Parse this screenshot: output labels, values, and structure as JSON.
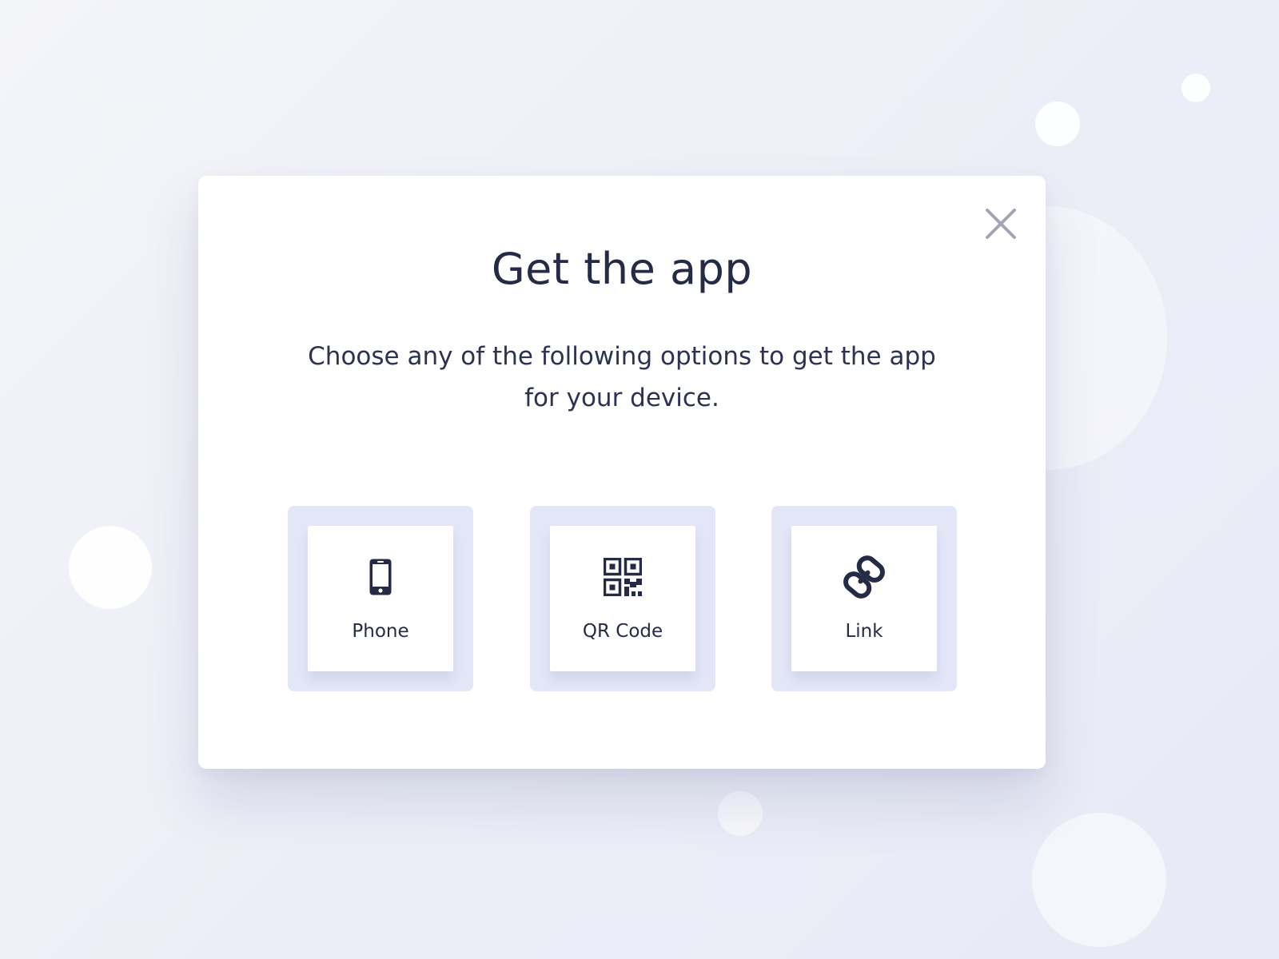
{
  "modal": {
    "title": "Get the app",
    "subtitle": "Choose any of the following options to get the app for your device.",
    "close_icon": "close-icon"
  },
  "options": [
    {
      "label": "Phone",
      "icon": "phone-icon"
    },
    {
      "label": "QR Code",
      "icon": "qr-code-icon"
    },
    {
      "label": "Link",
      "icon": "link-icon"
    }
  ],
  "colors": {
    "text": "#252b45",
    "option_frame": "#e2e6f7",
    "close_icon": "#a3a6b4",
    "background": "#eceef7"
  }
}
